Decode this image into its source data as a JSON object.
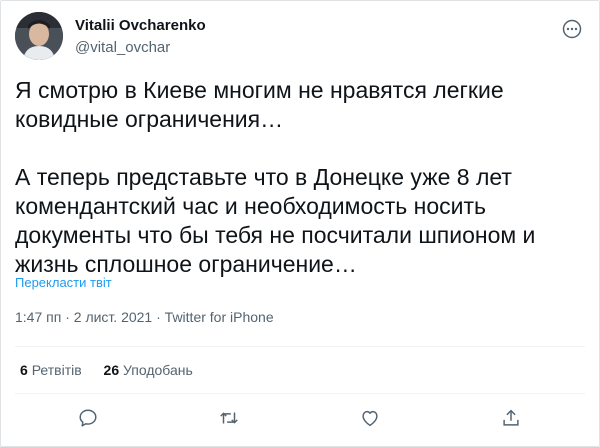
{
  "author": {
    "name": "Vitalii Ovcharenko",
    "handle": "@vital_ovchar",
    "avatar_icon": "user-avatar"
  },
  "tweet": {
    "text": "Я смотрю в Киеве многим не нравятся легкие\nковидные ограничения…\n\nА теперь представьте что в Донецке уже 8 лет\nкомендантский час и необходимость носить\nдокументы что бы тебя не посчитали шпионом и\nжизнь сплошное ограничение…",
    "translate_label": "Перекласти твіт",
    "time": "1:47 пп",
    "date": "2 лист. 2021",
    "source": "Twitter for iPhone",
    "dot": "·"
  },
  "stats": {
    "retweets_count": "6",
    "retweets_label": "Ретвітів",
    "likes_count": "26",
    "likes_label": "Уподобань"
  },
  "actions": [
    "reply-icon",
    "retweet-icon",
    "like-icon",
    "share-icon"
  ],
  "colors": {
    "text": "#0f1419",
    "secondary": "#536471",
    "link": "#1d9bf0",
    "divider": "#eff3f4"
  }
}
